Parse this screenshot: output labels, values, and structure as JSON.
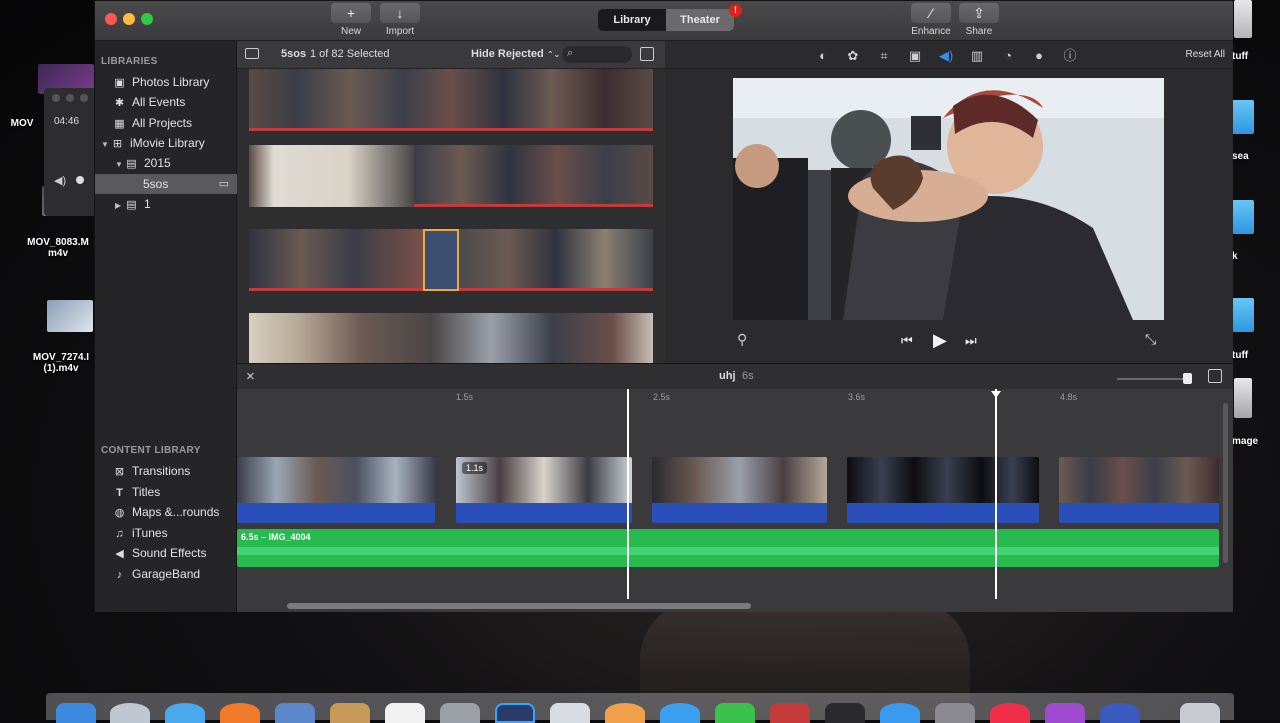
{
  "desktop": {
    "left_icons": [
      {
        "label": "MOV"
      },
      {
        "label": "MOV_8083.M m4v"
      },
      {
        "label": "MOV_7274.I (1).m4v"
      }
    ],
    "right_labels": [
      "tuff",
      "sea",
      "k",
      "tuff",
      "mage"
    ],
    "quicktime": {
      "time": "04:46"
    }
  },
  "toolbar": {
    "new_label": "New",
    "import_label": "Import",
    "library_tab": "Library",
    "theater_tab": "Theater",
    "theater_badge": "!",
    "enhance_label": "Enhance",
    "share_label": "Share"
  },
  "sidebar": {
    "libraries_header": "LIBRARIES",
    "items": [
      {
        "label": "Photos Library",
        "icon": "photos-icon"
      },
      {
        "label": "All Events",
        "icon": "star-icon"
      },
      {
        "label": "All Projects",
        "icon": "grid-icon"
      },
      {
        "label": "iMovie Library",
        "icon": "library-icon"
      },
      {
        "label": "2015",
        "icon": "folder-icon"
      },
      {
        "label": "5sos",
        "icon": "event-icon"
      },
      {
        "label": "1",
        "icon": "folder-icon"
      }
    ],
    "content_header": "CONTENT LIBRARY",
    "content_items": [
      {
        "label": "Transitions",
        "icon": "transitions-icon"
      },
      {
        "label": "Titles",
        "icon": "titles-icon"
      },
      {
        "label": "Maps &...rounds",
        "icon": "globe-icon"
      },
      {
        "label": "iTunes",
        "icon": "music-note-icon"
      },
      {
        "label": "Sound Effects",
        "icon": "speaker-icon"
      },
      {
        "label": "GarageBand",
        "icon": "guitar-icon"
      }
    ]
  },
  "browser": {
    "event_name": "5sos",
    "selection_count": "1 of 82 Selected",
    "filter": "Hide Rejected",
    "filter_chevron": "⌃⌄"
  },
  "viewer": {
    "reset_label": "Reset All",
    "colors": {
      "accent": "#3a8ee6"
    }
  },
  "timeline": {
    "project_name": "uhj",
    "duration": "6s",
    "ruler": [
      "1.5s",
      "2.5s",
      "3.6s",
      "4.8s"
    ],
    "clip_tooltip": "1.1s",
    "audio_label": "6.5s – IMG_4004"
  }
}
